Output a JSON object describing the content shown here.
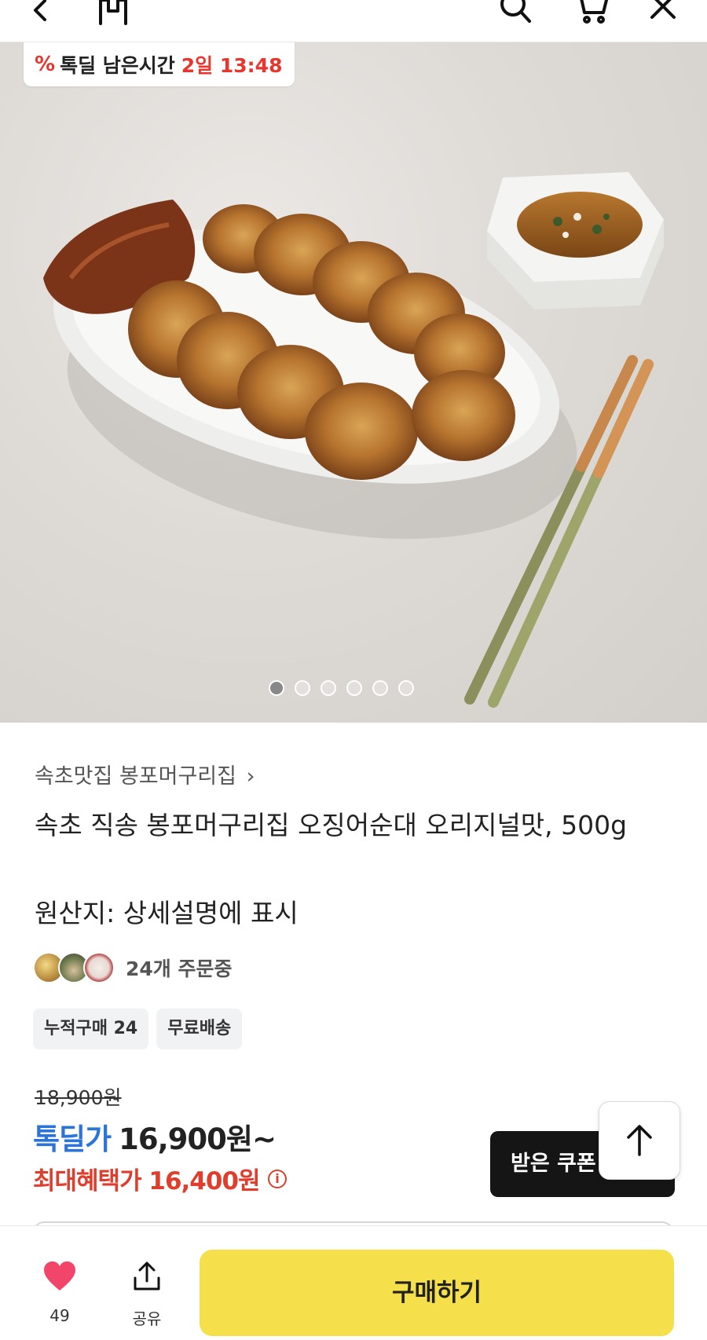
{
  "header": {
    "icons": [
      "back-icon",
      "home-icon",
      "search-icon",
      "cart-icon",
      "close-icon"
    ]
  },
  "hero": {
    "deal_badge": {
      "icon": "percent-icon",
      "label": "톡딜 남은시간",
      "time": "2일 13:48"
    },
    "carousel": {
      "total": 6,
      "current": 1
    }
  },
  "product": {
    "seller": "속초맛집 봉포머구리집",
    "seller_chevron": "›",
    "title": "속초 직송 봉포머구리집 오징어순대 오리지널맛, 500g",
    "origin": "원산지: 상세설명에 표시",
    "orders_text": "24개 주문중",
    "tags": [
      "누적구매 24",
      "무료배송"
    ]
  },
  "price": {
    "original": "18,900원",
    "deal_label": "톡딜가",
    "deal_price": "16,900원~",
    "max_benefit": "최대혜택가 16,400원",
    "info_symbol": "i"
  },
  "coupon": {
    "label": "받은 쿠폰"
  },
  "bottom_bar": {
    "like_count": "49",
    "share_label": "공유",
    "buy_label": "구매하기"
  },
  "colors": {
    "accent_red": "#e8352d",
    "deal_blue": "#2b74d9",
    "buy_yellow": "#f5e04b",
    "heart_pink": "#f2456a"
  }
}
